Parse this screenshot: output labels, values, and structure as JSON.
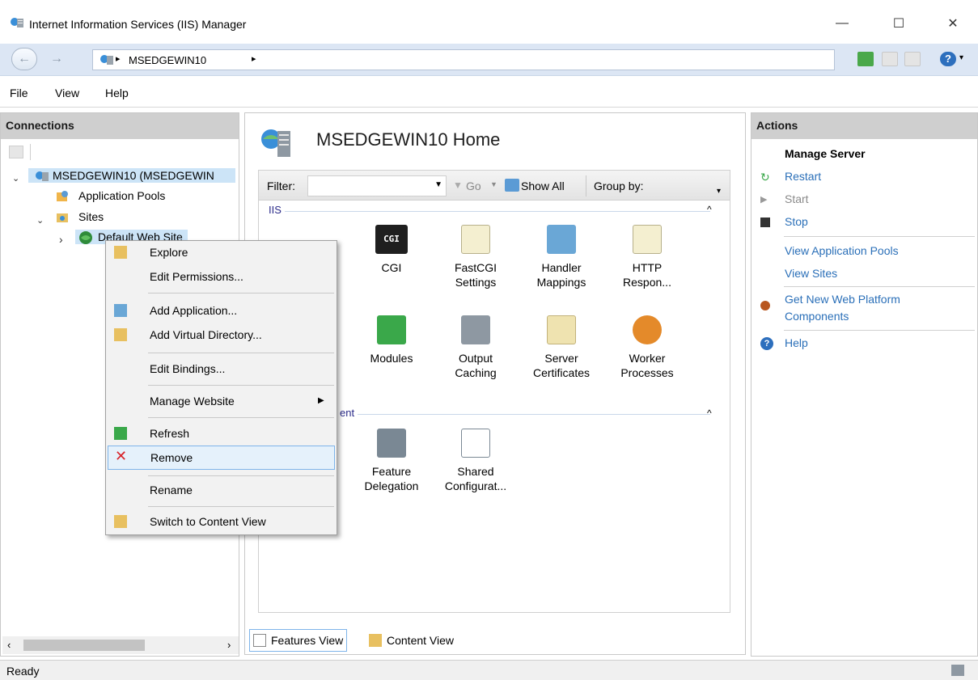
{
  "window": {
    "title": "Internet Information Services (IIS) Manager",
    "controls": {
      "minimize": "—",
      "maximize": "☐",
      "close": "✕"
    }
  },
  "address": {
    "back": "←",
    "forward": "→",
    "breadcrumb": "MSEDGEWIN10",
    "separator": "▸",
    "help_glyph": "?"
  },
  "menu": {
    "file": "File",
    "view": "View",
    "help": "Help"
  },
  "connections": {
    "header": "Connections",
    "tree": {
      "server": "MSEDGEWIN10 (MSEDGEWIN",
      "app_pools": "Application Pools",
      "sites": "Sites",
      "default_site": "Default Web Site"
    }
  },
  "center": {
    "title": "MSEDGEWIN10 Home",
    "filter_label": "Filter:",
    "go": "Go",
    "show_all": "Show All",
    "group_by": "Group by:",
    "group_iis": "IIS",
    "group_management": "ent",
    "cgi_badge": "CGI",
    "features": {
      "cgi": "CGI",
      "fastcgi": "FastCGI Settings",
      "handler": "Handler Mappings",
      "http": "HTTP Respon...",
      "modules": "Modules",
      "output": "Output Caching",
      "certs": "Server Certificates",
      "worker": "Worker Processes",
      "delegation": "Feature Delegation",
      "shared": "Shared Configurat..."
    },
    "tabs": {
      "features_view": "Features View",
      "content_view": "Content View"
    }
  },
  "actions": {
    "header": "Actions",
    "manage_server": "Manage Server",
    "restart": "Restart",
    "start": "Start",
    "stop": "Stop",
    "view_pools": "View Application Pools",
    "view_sites": "View Sites",
    "get_new_1": "Get New Web Platform",
    "get_new_2": "Components",
    "help": "Help"
  },
  "context_menu": {
    "explore": "Explore",
    "edit_permissions": "Edit Permissions...",
    "add_application": "Add Application...",
    "add_virtual_dir": "Add Virtual Directory...",
    "edit_bindings": "Edit Bindings...",
    "manage_website": "Manage Website",
    "refresh": "Refresh",
    "remove": "Remove",
    "rename": "Rename",
    "switch_content": "Switch to Content View"
  },
  "status": {
    "text": "Ready"
  },
  "colors": {
    "accent_link": "#2a6fb8",
    "address_bar": "#dce6f4",
    "panel_header": "#cfcfcf",
    "menu_highlight": "#e5f1fb",
    "remove_red": "#d8232a"
  }
}
